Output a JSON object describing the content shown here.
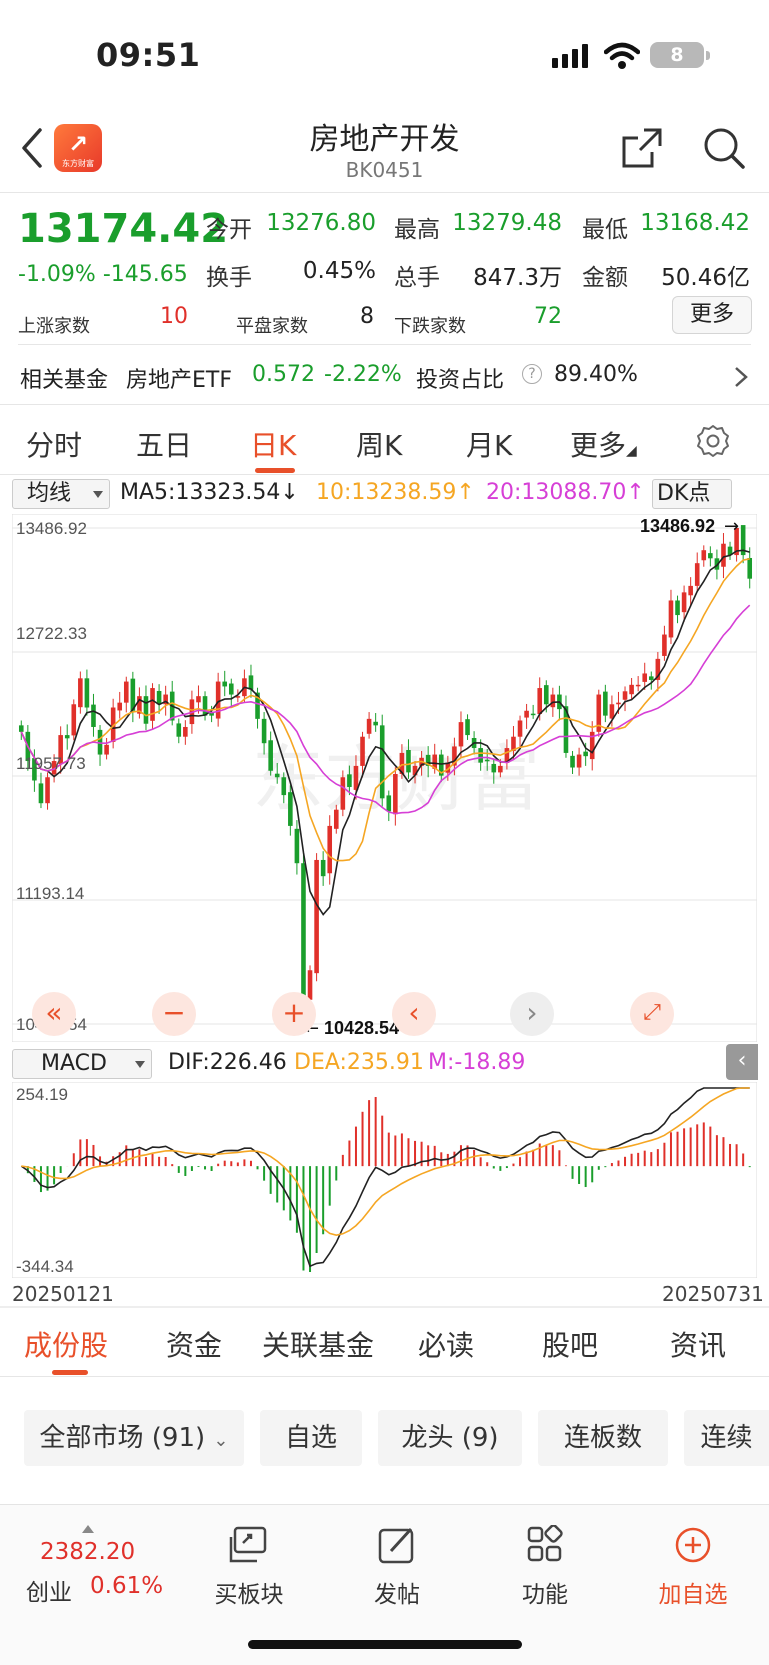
{
  "status_bar": {
    "time": "09:51",
    "battery": "8"
  },
  "header": {
    "title": "房地产开发",
    "code": "BK0451",
    "logo_text": "东方财富"
  },
  "quote": {
    "price": "13174.42",
    "change": "-1.09% -145.65",
    "open_label": "今开",
    "open": "13276.80",
    "high_label": "最高",
    "high": "13279.48",
    "low_label": "最低",
    "low": "13168.42",
    "turnover_label": "换手",
    "turnover": "0.45%",
    "volume_label": "总手",
    "volume": "847.3万",
    "amount_label": "金额",
    "amount": "50.46亿",
    "up_label": "上涨家数",
    "up": "10",
    "flat_label": "平盘家数",
    "flat": "8",
    "down_label": "下跌家数",
    "down": "72",
    "more_button": "更多"
  },
  "related_fund": {
    "label": "相关基金",
    "name": "房地产ETF",
    "price": "0.572",
    "change": "-2.22%",
    "ratio_label": "投资占比",
    "ratio": "89.40%"
  },
  "chart_tabs": [
    "分时",
    "五日",
    "日K",
    "周K",
    "月K",
    "更多"
  ],
  "chart_tabs_active": "日K",
  "indicator_bar": {
    "selector": "均线",
    "ma5": "MA5:13323.54↓",
    "ma10": "10:13238.59↑",
    "ma20": "20:13088.70↑",
    "dk": "DK点"
  },
  "colors": {
    "up": "#e0302a",
    "down": "#1a9e2c",
    "ma5": "#222222",
    "ma10": "#f5a623",
    "ma20": "#d63fd6",
    "accent": "#e8502a"
  },
  "kline": {
    "axis_labels": [
      "13486.92",
      "12722.33",
      "11957.73",
      "11193.14",
      "10428.54"
    ],
    "max_marker": "13486.92",
    "min_marker": "10428.54",
    "watermark": "东方财富"
  },
  "chart_controls": [
    "rewind-icon",
    "zoom-out-icon",
    "zoom-in-icon",
    "prev-icon",
    "next-icon",
    "fullscreen-icon"
  ],
  "macd_bar": {
    "selector": "MACD",
    "dif": "DIF:226.46",
    "dea": "DEA:235.91",
    "m": "M:-18.89"
  },
  "macd": {
    "top_label": "254.19",
    "bottom_label": "-344.34"
  },
  "dates": {
    "start": "20250121",
    "end": "20250731"
  },
  "bottom_tabs": [
    "成份股",
    "资金",
    "关联基金",
    "必读",
    "股吧",
    "资讯"
  ],
  "filters": [
    "全部市场 (91)",
    "自选",
    "龙头 (9)",
    "连板数",
    "连续"
  ],
  "bottom_nav": {
    "index_value": "2382.20",
    "index_name": "创业",
    "index_change": "0.61%",
    "items": [
      "买板块",
      "发帖",
      "功能",
      "加自选"
    ]
  },
  "chart_data": [
    {
      "type": "candlestick",
      "title": "",
      "x_range": [
        "20250121",
        "20250731"
      ],
      "ylim": [
        10428.54,
        13486.92
      ],
      "y_ticks": [
        13486.92,
        12722.33,
        11957.73,
        11193.14,
        10428.54
      ],
      "max": 13486.92,
      "min": 10428.54,
      "close": [
        12230,
        12050,
        11930,
        11790,
        11950,
        12050,
        12210,
        12190,
        12400,
        12560,
        12380,
        12260,
        12090,
        12150,
        12380,
        12410,
        12540,
        12360,
        12450,
        12280,
        12500,
        12400,
        12460,
        12300,
        12200,
        12260,
        12430,
        12450,
        12330,
        12330,
        12540,
        12510,
        12460,
        12450,
        12560,
        12490,
        12310,
        12160,
        11990,
        11950,
        11840,
        11650,
        11420,
        10560,
        10760,
        11440,
        11340,
        11650,
        11750,
        11950,
        11890,
        12020,
        12200,
        12310,
        12270,
        11820,
        11740,
        11970,
        12100,
        11980,
        12020,
        12070,
        12020,
        12090,
        11960,
        12040,
        12140,
        12290,
        12210,
        12130,
        12040,
        12050,
        11980,
        12020,
        12130,
        12200,
        12300,
        12360,
        12340,
        12500,
        12400,
        12460,
        12370,
        12100,
        12010,
        12090,
        12080,
        12230,
        12460,
        12330,
        12400,
        12410,
        12480,
        12520,
        12520,
        12590,
        12550,
        12680,
        12830,
        13040,
        12950,
        13090,
        13130,
        13270,
        13350,
        13300,
        13230,
        13390,
        13320,
        13486.92,
        13320,
        13174.42
      ],
      "series": [
        {
          "name": "MA5",
          "value": 13323.54
        },
        {
          "name": "10",
          "value": 13238.59
        },
        {
          "name": "20",
          "value": 13088.7
        }
      ]
    },
    {
      "type": "bar",
      "title": "MACD",
      "ylim": [
        -344.34,
        254.19
      ],
      "series": [
        {
          "name": "DIF",
          "value": 226.46
        },
        {
          "name": "DEA",
          "value": 235.91
        },
        {
          "name": "M",
          "value": -18.89
        }
      ]
    }
  ]
}
